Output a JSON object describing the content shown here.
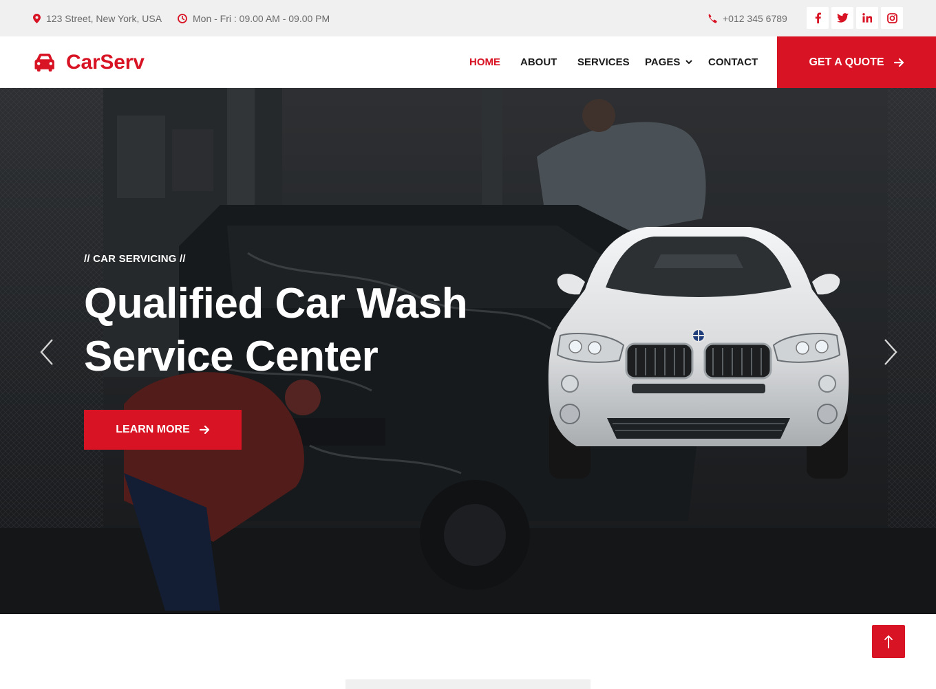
{
  "topbar": {
    "address": "123 Street, New York, USA",
    "hours": "Mon - Fri : 09.00 AM - 09.00 PM",
    "phone": "+012 345 6789",
    "socials": [
      "facebook-icon",
      "twitter-icon",
      "linkedin-icon",
      "instagram-icon"
    ]
  },
  "brand": {
    "name": "CarServ",
    "icon": "car-icon",
    "color": "#d81324"
  },
  "nav": {
    "items": [
      "HOME",
      "ABOUT",
      "SERVICES",
      "PAGES",
      "CONTACT"
    ],
    "active": "HOME",
    "cta": "GET A QUOTE"
  },
  "hero": {
    "subtitle": "// CAR SERVICING //",
    "title_line1": "Qualified Car Wash",
    "title_line2": "Service Center",
    "button": "LEARN MORE"
  },
  "colors": {
    "primary": "#d81324",
    "light": "#f0f0f0",
    "dark": "#1b1b1b"
  }
}
